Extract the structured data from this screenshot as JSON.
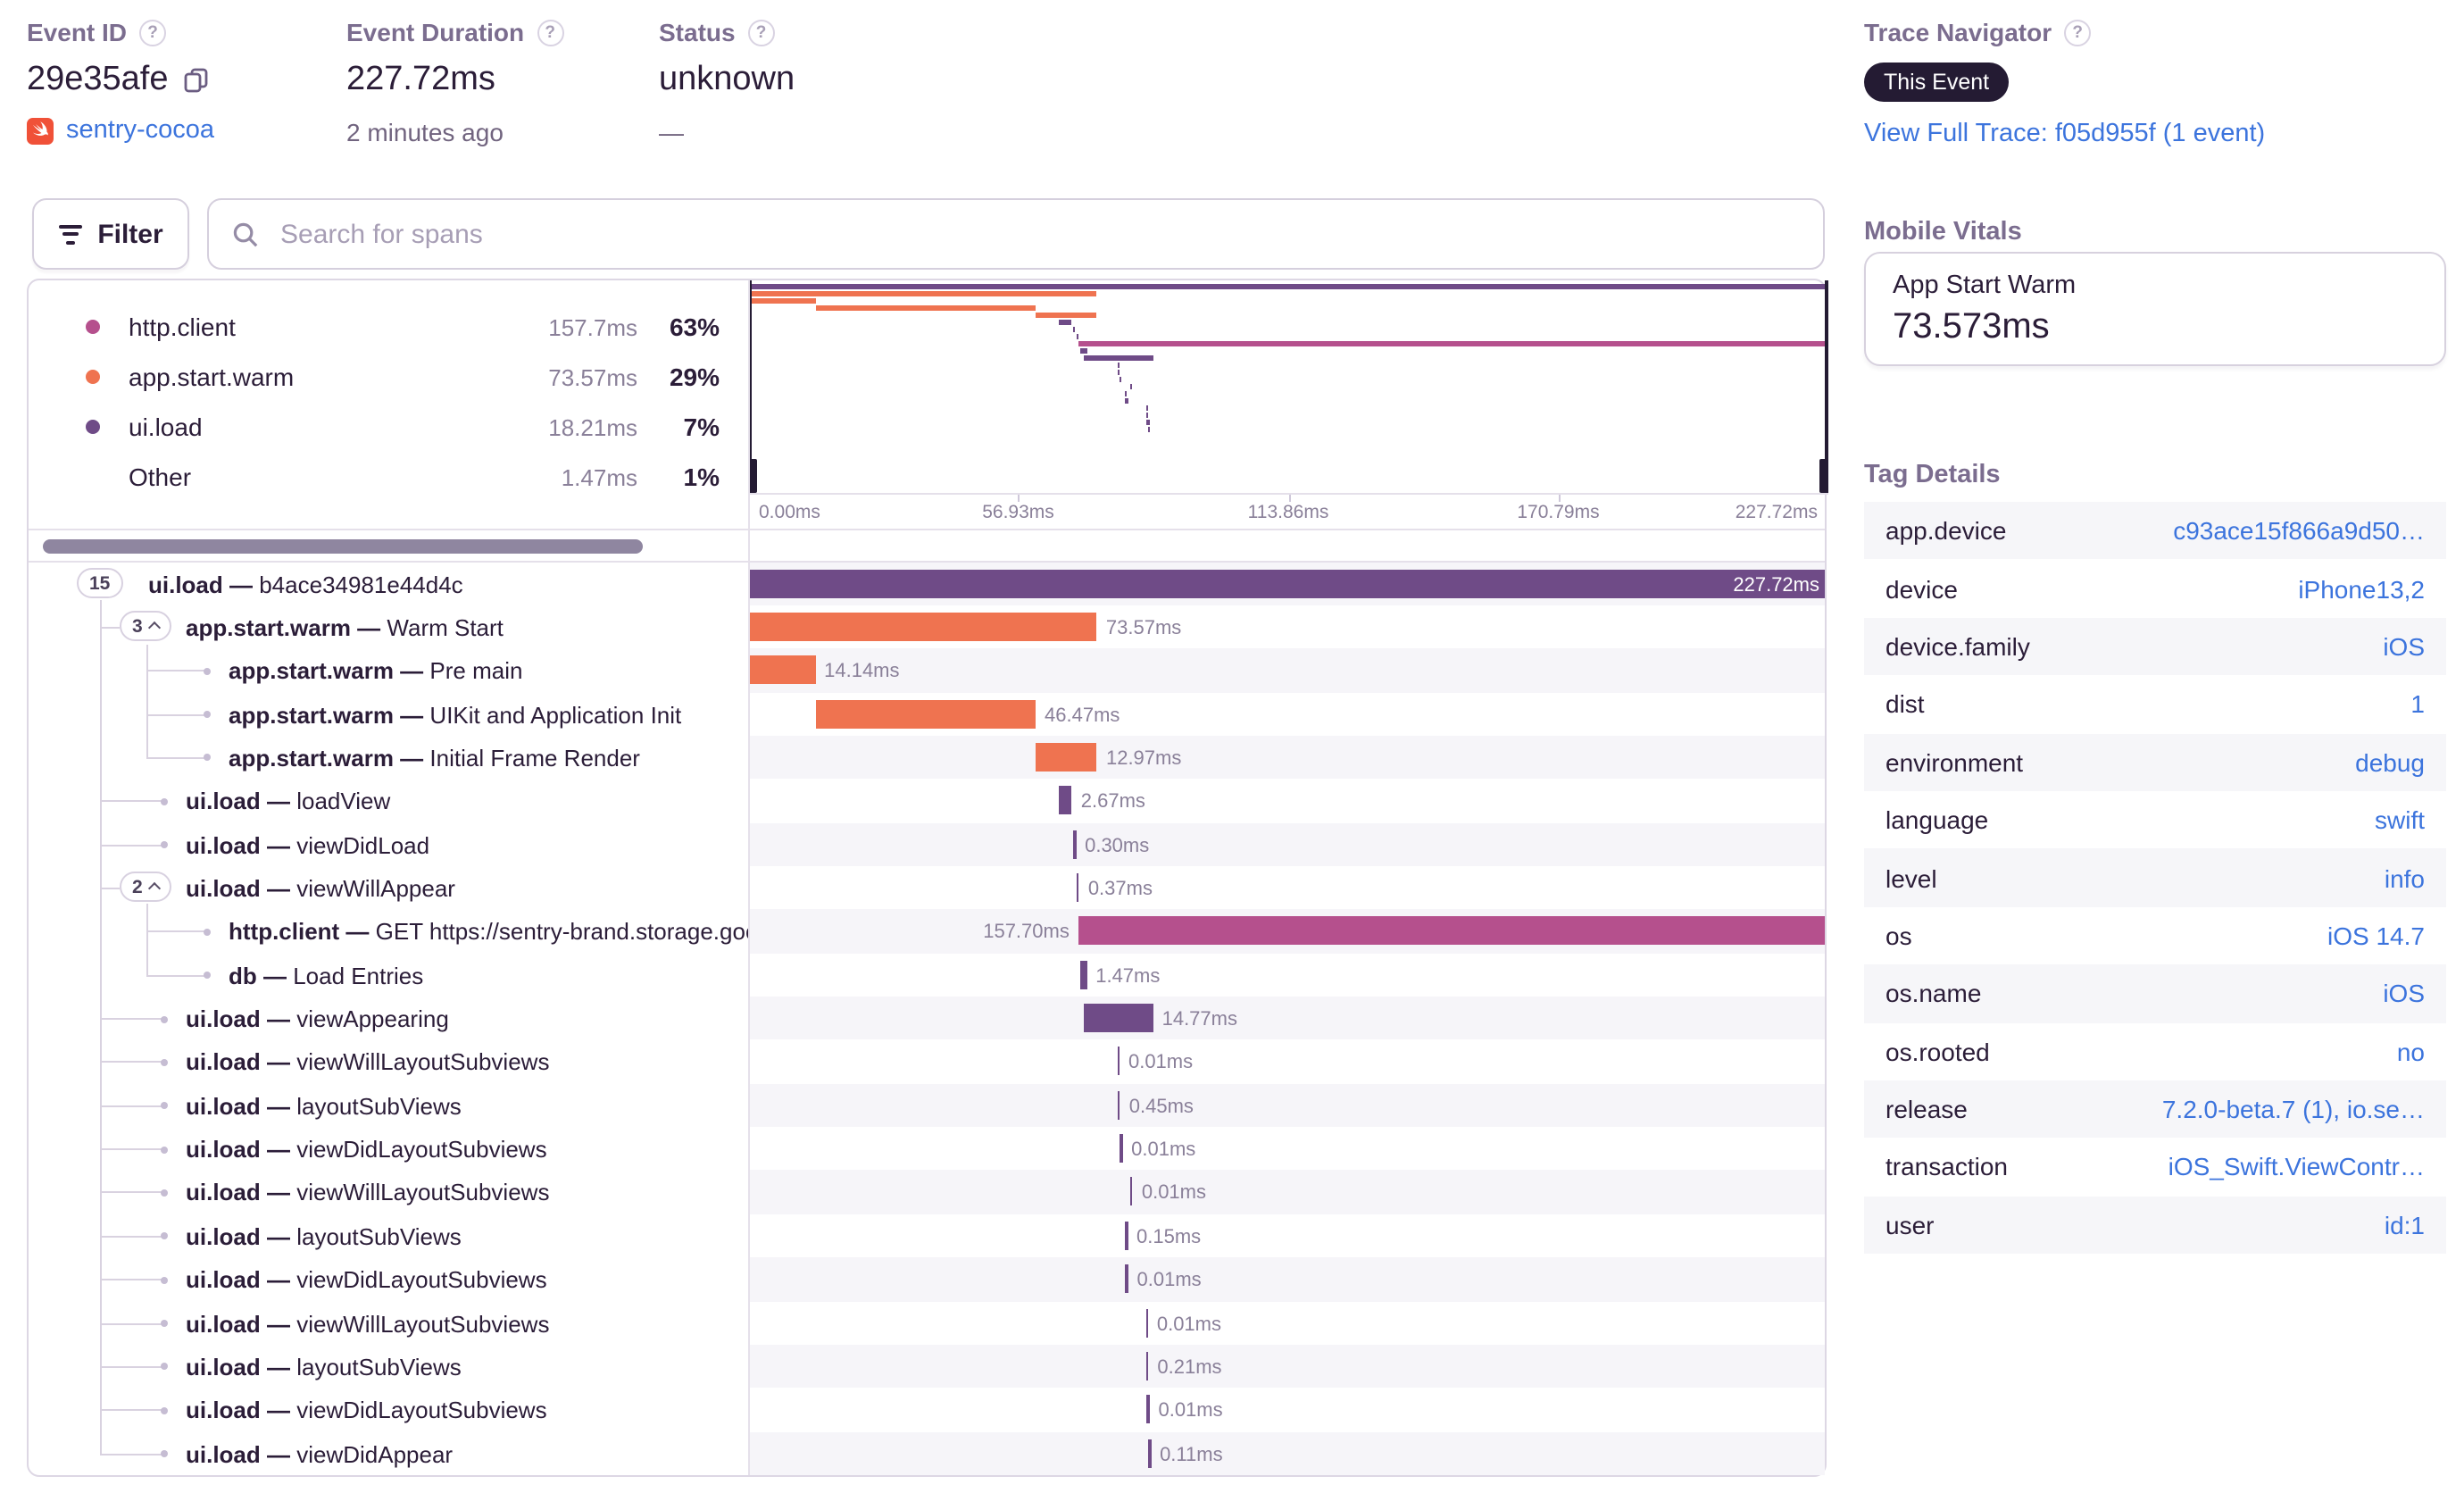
{
  "ui": {
    "qmark": "?",
    "sep": "—"
  },
  "header": {
    "event_id": {
      "label": "Event ID",
      "value": "29e35afe",
      "project": "sentry-cocoa"
    },
    "duration": {
      "label": "Event Duration",
      "value": "227.72ms",
      "ago": "2 minutes ago"
    },
    "status": {
      "label": "Status",
      "value": "unknown",
      "sub": "—"
    },
    "trace": {
      "label": "Trace Navigator",
      "badge": "This Event",
      "link": "View Full Trace: f05d955f (1 event)"
    }
  },
  "toolbar": {
    "filter": "Filter",
    "search_placeholder": "Search for spans"
  },
  "legend": [
    {
      "op": "http.client",
      "duration": "157.7ms",
      "pct": "63%",
      "color": "#B5508D"
    },
    {
      "op": "app.start.warm",
      "duration": "73.57ms",
      "pct": "29%",
      "color": "#EF7350"
    },
    {
      "op": "ui.load",
      "duration": "18.21ms",
      "pct": "7%",
      "color": "#6F4B87"
    },
    {
      "op": "Other",
      "duration": "1.47ms",
      "pct": "1%",
      "color": null
    }
  ],
  "axis_ticks": [
    "0.00ms",
    "56.93ms",
    "113.86ms",
    "170.79ms",
    "227.72ms"
  ],
  "total_ms": 227.72,
  "spans": [
    {
      "op": "ui.load",
      "desc": "b4ace34981e44d4c",
      "start": 0,
      "dur": 227.72,
      "label": "227.72ms",
      "level": 0,
      "pill": "15",
      "chevron": false,
      "color": "#6F4B87",
      "label_pos": "inside"
    },
    {
      "op": "app.start.warm",
      "desc": "Warm Start",
      "start": 0,
      "dur": 73.57,
      "label": "73.57ms",
      "level": 1,
      "pill": "3",
      "chevron": true,
      "color": "#EF7350"
    },
    {
      "op": "app.start.warm",
      "desc": "Pre main",
      "start": 0,
      "dur": 14.14,
      "label": "14.14ms",
      "level": 2,
      "color": "#EF7350"
    },
    {
      "op": "app.start.warm",
      "desc": "UIKit and Application Init",
      "start": 14.14,
      "dur": 46.47,
      "label": "46.47ms",
      "level": 2,
      "color": "#EF7350"
    },
    {
      "op": "app.start.warm",
      "desc": "Initial Frame Render",
      "start": 60.61,
      "dur": 12.97,
      "label": "12.97ms",
      "level": 2,
      "color": "#EF7350"
    },
    {
      "op": "ui.load",
      "desc": "loadView",
      "start": 65.6,
      "dur": 2.67,
      "label": "2.67ms",
      "level": 1,
      "color": "#6F4B87"
    },
    {
      "op": "ui.load",
      "desc": "viewDidLoad",
      "start": 68.6,
      "dur": 0.3,
      "label": "0.30ms",
      "level": 1,
      "color": "#6F4B87"
    },
    {
      "op": "ui.load",
      "desc": "viewWillAppear",
      "start": 69.3,
      "dur": 0.37,
      "label": "0.37ms",
      "level": 1,
      "pill": "2",
      "chevron": true,
      "color": "#6F4B87"
    },
    {
      "op": "http.client",
      "desc": "GET https://sentry-brand.storage.googlea",
      "start": 69.6,
      "dur": 157.7,
      "label": "157.70ms",
      "level": 2,
      "color": "#B5508D",
      "label_pos": "left"
    },
    {
      "op": "db",
      "desc": "Load Entries",
      "start": 69.9,
      "dur": 1.47,
      "label": "1.47ms",
      "level": 2,
      "color": "#6F4B87"
    },
    {
      "op": "ui.load",
      "desc": "viewAppearing",
      "start": 70.6,
      "dur": 14.77,
      "label": "14.77ms",
      "level": 1,
      "color": "#6F4B87"
    },
    {
      "op": "ui.load",
      "desc": "viewWillLayoutSubviews",
      "start": 77.8,
      "dur": 0.01,
      "label": "0.01ms",
      "level": 1,
      "color": "#6F4B87"
    },
    {
      "op": "ui.load",
      "desc": "layoutSubViews",
      "start": 77.95,
      "dur": 0.45,
      "label": "0.45ms",
      "level": 1,
      "color": "#6F4B87"
    },
    {
      "op": "ui.load",
      "desc": "viewDidLayoutSubviews",
      "start": 78.4,
      "dur": 0.01,
      "label": "0.01ms",
      "level": 1,
      "color": "#6F4B87"
    },
    {
      "op": "ui.load",
      "desc": "viewWillLayoutSubviews",
      "start": 80.6,
      "dur": 0.01,
      "label": "0.01ms",
      "level": 1,
      "color": "#6F4B87"
    },
    {
      "op": "ui.load",
      "desc": "layoutSubViews",
      "start": 79.5,
      "dur": 0.15,
      "label": "0.15ms",
      "level": 1,
      "color": "#6F4B87"
    },
    {
      "op": "ui.load",
      "desc": "viewDidLayoutSubviews",
      "start": 79.6,
      "dur": 0.01,
      "label": "0.01ms",
      "level": 1,
      "color": "#6F4B87"
    },
    {
      "op": "ui.load",
      "desc": "viewWillLayoutSubviews",
      "start": 83.8,
      "dur": 0.01,
      "label": "0.01ms",
      "level": 1,
      "color": "#6F4B87"
    },
    {
      "op": "ui.load",
      "desc": "layoutSubViews",
      "start": 83.9,
      "dur": 0.21,
      "label": "0.21ms",
      "level": 1,
      "color": "#6F4B87"
    },
    {
      "op": "ui.load",
      "desc": "viewDidLayoutSubviews",
      "start": 84.1,
      "dur": 0.01,
      "label": "0.01ms",
      "level": 1,
      "color": "#6F4B87"
    },
    {
      "op": "ui.load",
      "desc": "viewDidAppear",
      "start": 84.4,
      "dur": 0.11,
      "label": "0.11ms",
      "level": 1,
      "color": "#6F4B87"
    }
  ],
  "mobile_vitals": {
    "title": "Mobile Vitals",
    "card_title": "App Start Warm",
    "card_value": "73.573ms"
  },
  "tag_details": {
    "title": "Tag Details",
    "rows": [
      {
        "key": "app.device",
        "value": "c93ace15f866a9d50…"
      },
      {
        "key": "device",
        "value": "iPhone13,2"
      },
      {
        "key": "device.family",
        "value": "iOS"
      },
      {
        "key": "dist",
        "value": "1"
      },
      {
        "key": "environment",
        "value": "debug"
      },
      {
        "key": "language",
        "value": "swift"
      },
      {
        "key": "level",
        "value": "info"
      },
      {
        "key": "os",
        "value": "iOS 14.7"
      },
      {
        "key": "os.name",
        "value": "iOS"
      },
      {
        "key": "os.rooted",
        "value": "no"
      },
      {
        "key": "release",
        "value": "7.2.0-beta.7 (1), io.se…"
      },
      {
        "key": "transaction",
        "value": "iOS_Swift.ViewContr…"
      },
      {
        "key": "user",
        "value": "id:1"
      }
    ]
  }
}
